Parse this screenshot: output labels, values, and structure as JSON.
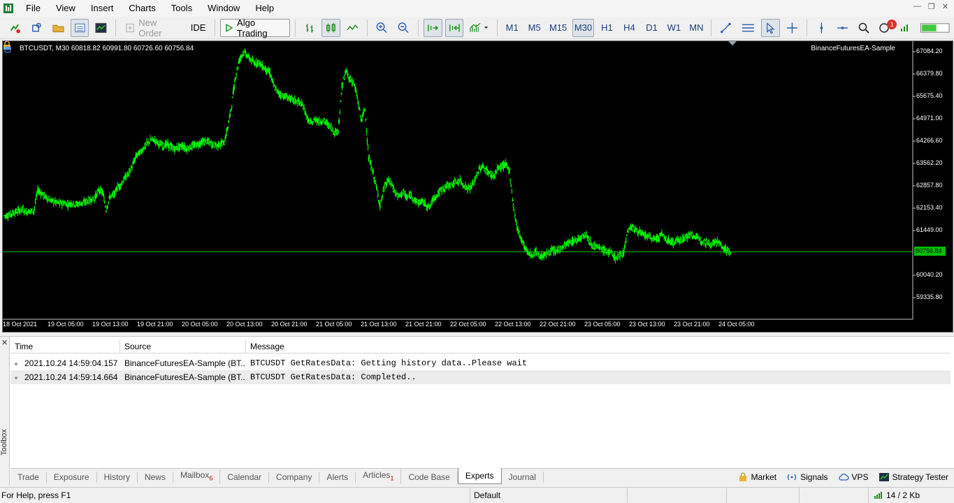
{
  "menu": [
    "File",
    "View",
    "Insert",
    "Charts",
    "Tools",
    "Window",
    "Help"
  ],
  "toolbar": {
    "new_order": "New Order",
    "ide": "IDE",
    "algo_trading": "Algo Trading",
    "timeframes": [
      "M1",
      "M5",
      "M15",
      "M30",
      "H1",
      "H4",
      "D1",
      "W1",
      "MN"
    ],
    "active_timeframe": "M30",
    "notification_count": "1"
  },
  "chart": {
    "title": "BTCUSDT, M30  60818.82 60991.80 60726.60 60756.84",
    "expert": "BinanceFuturesEA-Sample",
    "last_price": "60756.84",
    "price_labels": [
      "67084.20",
      "66379.80",
      "65675.40",
      "64971.00",
      "64266.60",
      "63562.20",
      "62857.80",
      "62153.40",
      "61449.00",
      "60040.20",
      "59335.80"
    ],
    "time_labels": [
      "18 Oct 2021",
      "19 Oct 05:00",
      "19 Oct 13:00",
      "19 Oct 21:00",
      "20 Oct 05:00",
      "20 Oct 13:00",
      "20 Oct 21:00",
      "21 Oct 05:00",
      "21 Oct 13:00",
      "21 Oct 21:00",
      "22 Oct 05:00",
      "22 Oct 13:00",
      "22 Oct 21:00",
      "23 Oct 05:00",
      "23 Oct 13:00",
      "23 Oct 21:00",
      "24 Oct 05:00"
    ],
    "colors": {
      "background": "#000000",
      "candle": "#00ff00",
      "text": "#ffffff"
    },
    "price_series": [
      61900,
      61950,
      62000,
      62050,
      62100,
      62000,
      62050,
      62050,
      62700,
      62600,
      62500,
      62400,
      62350,
      62300,
      62280,
      62300,
      62250,
      62300,
      62250,
      62280,
      62300,
      62350,
      62400,
      62450,
      62700,
      62650,
      62100,
      62500,
      62550,
      62800,
      62900,
      63100,
      63250,
      63500,
      63800,
      63900,
      64050,
      64200,
      64300,
      64250,
      64150,
      64100,
      64150,
      64050,
      64000,
      64050,
      64100,
      64000,
      64050,
      64100,
      64150,
      64200,
      64250,
      64200,
      64150,
      64100,
      64150,
      64200,
      64700,
      65400,
      66300,
      66800,
      67050,
      66950,
      66800,
      66700,
      66750,
      66600,
      66500,
      66400,
      66000,
      65800,
      65700,
      65650,
      65600,
      65550,
      65500,
      65450,
      65300,
      64900,
      64800,
      64950,
      64850,
      64900,
      64800,
      64700,
      64500,
      64600,
      66000,
      66450,
      66200,
      66100,
      65600,
      64900,
      65250,
      63700,
      63300,
      62800,
      62200,
      62750,
      63000,
      62900,
      62600,
      62500,
      62650,
      62450,
      62550,
      62400,
      62300,
      62350,
      62250,
      62150,
      62450,
      62550,
      62700,
      62800,
      62850,
      62900,
      62950,
      63000,
      62850,
      62750,
      62800,
      63050,
      63350,
      63450,
      63300,
      63200,
      63150,
      63400,
      63450,
      63500,
      63300,
      62200,
      61500,
      61200,
      60900,
      60700,
      60650,
      60750,
      60600,
      60650,
      60700,
      60800,
      60750,
      60850,
      60900,
      61000,
      61050,
      61100,
      61150,
      61250,
      61350,
      61100,
      60950,
      60900,
      60850,
      60800,
      60750,
      60700,
      60550,
      60650,
      60750,
      61400,
      61550,
      61450,
      61400,
      61300,
      61250,
      61200,
      61150,
      61200,
      61300,
      61150,
      61100,
      61050,
      61100,
      61150,
      61200,
      61250,
      61300,
      61200,
      61150,
      61100,
      61050,
      61000,
      61100,
      61050,
      60900,
      60800,
      60757
    ]
  },
  "log": {
    "headers": [
      "Time",
      "Source",
      "Message"
    ],
    "rows": [
      {
        "time": "2021.10.24 14:59:04.157",
        "source": "BinanceFuturesEA-Sample (BT...",
        "message": "BTCUSDT GetRatesData: Getting history data..Please wait"
      },
      {
        "time": "2021.10.24 14:59:14.664",
        "source": "BinanceFuturesEA-Sample (BT...",
        "message": "BTCUSDT GetRatesData: Completed.."
      }
    ]
  },
  "toolbox_label": "Toolbox",
  "tabs": [
    {
      "label": "Trade",
      "badge": ""
    },
    {
      "label": "Exposure",
      "badge": ""
    },
    {
      "label": "History",
      "badge": ""
    },
    {
      "label": "News",
      "badge": ""
    },
    {
      "label": "Mailbox",
      "badge": "6"
    },
    {
      "label": "Calendar",
      "badge": ""
    },
    {
      "label": "Company",
      "badge": ""
    },
    {
      "label": "Alerts",
      "badge": ""
    },
    {
      "label": "Articles",
      "badge": "1"
    },
    {
      "label": "Code Base",
      "badge": ""
    },
    {
      "label": "Experts",
      "badge": ""
    },
    {
      "label": "Journal",
      "badge": ""
    }
  ],
  "active_tab": "Experts",
  "right_tabs": [
    "Market",
    "Signals",
    "VPS",
    "Strategy Tester"
  ],
  "status": {
    "help": "For Help, press F1",
    "profile": "Default",
    "traffic": "14 / 2 Kb"
  }
}
